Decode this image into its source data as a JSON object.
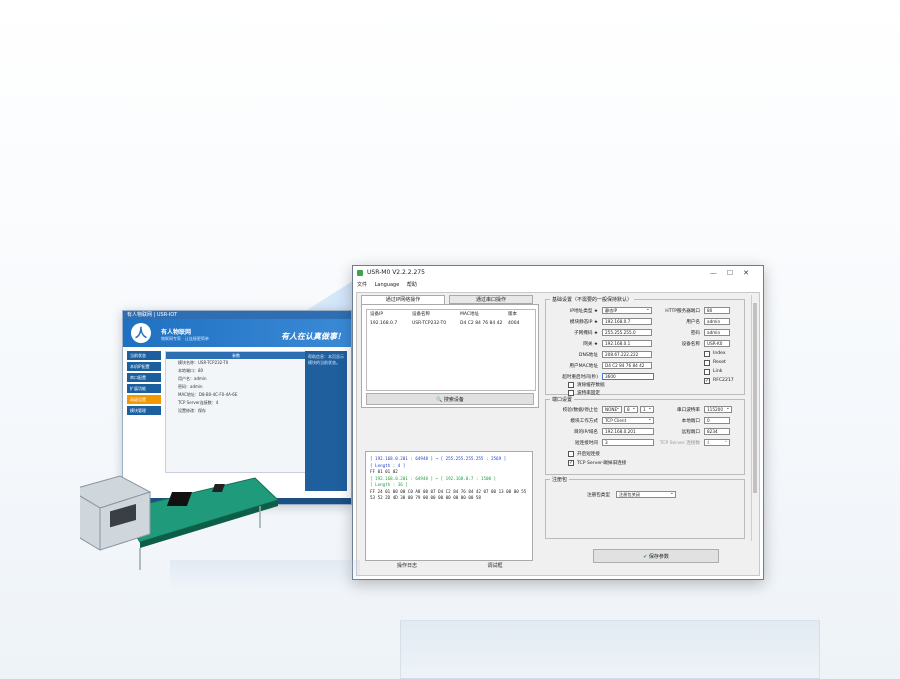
{
  "browser": {
    "titlebar": "有人物联网 | USR-IOT",
    "brand": "有人物联网",
    "brand_sub": "物联网专家 · 让连接更简单",
    "slogan": "有人在认真做事！",
    "side_items": [
      "当前状态",
      "本机IP配置",
      "串口配置",
      "扩展功能",
      "高级设置",
      "模块管理"
    ],
    "content_bar": "参数",
    "content_rows": [
      "模块名称：USR-TCP232-T0",
      "本地端口：80",
      "用户名：admin",
      "密码：admin",
      "MAC地址：D8-B0-4C-F0-4A-6E",
      "TCP Server连接数：4",
      "设置修改：保存"
    ],
    "right_panel": "帮助信息：本页显示模块的当前状态。"
  },
  "app": {
    "title": "USR-M0 V2.2.2.275",
    "menu": [
      "文件",
      "Language",
      "帮助"
    ],
    "window_controls": [
      "—",
      "☐",
      "✕"
    ],
    "tabs": [
      "通过IP网络操作",
      "通过串口操作"
    ],
    "device_list": {
      "headers": [
        "设备IP",
        "设备名称",
        "MAC地址",
        "版本"
      ],
      "rows": [
        [
          "192.168.0.7",
          "USR-TCP232-T0",
          "D4 C2 84 76 84 42",
          "4004"
        ]
      ]
    },
    "search_button": "搜索设备",
    "log": [
      {
        "cls": "blue",
        "text": "[ 192.168.0.201 : 64948 ] → [ 255.255.255.255 : 2569 ]"
      },
      {
        "cls": "blue",
        "text": "[ Length : 4 ]"
      },
      {
        "cls": "",
        "text": "FF 01 01 02"
      },
      {
        "cls": "",
        "text": " "
      },
      {
        "cls": "green",
        "text": "[ 192.168.0.201 : 64948 ] ← [ 192.168.0.7 : 1500 ]"
      },
      {
        "cls": "green",
        "text": "[ Length : 36 ]"
      },
      {
        "cls": "",
        "text": "FF 24 01 00 00 C0 A8 00 07 D4 C2 84 76 84 42 07 00 13 00 00 55 53 52 2D 4D 30 00 79 00 00 00 00 00 00 00 58"
      }
    ],
    "bottom_tabs": [
      "操作日志",
      "调试框"
    ],
    "basic": {
      "group_title": "基础设置（不需要的一般保持默认）",
      "ip_type_label": "IP地址类型 ★",
      "ip_type": "静态IP",
      "ip_label": "模块静态IP ★",
      "ip": "192.168.0.7",
      "mask_label": "子网掩码 ★",
      "mask": "255.255.255.0",
      "gw_label": "网关 ★",
      "gw": "192.168.0.1",
      "dns_label": "DNS地址",
      "dns": "208.67.222.222",
      "mac_label": "用户MAC地址",
      "mac": "D4 C2 84 76 84 42",
      "timeout_label": "超时重启时间(秒)",
      "timeout": "3600",
      "http_port_label": "HTTP服务器端口",
      "http_port": "80",
      "user_label": "用户名",
      "user": "admin",
      "pwd_label": "密码",
      "pwd": "admin",
      "name_label": "设备名称",
      "name": "USR-K0",
      "chk_index": "Index",
      "chk_reset": "Reset",
      "chk_link": "Link",
      "chk_rfc": "RFC2217",
      "chk_clear": "清除缓存数据",
      "chk_baud": "波特率固定"
    },
    "serial": {
      "group_title": "端口设置",
      "check_label": "校验/数据/停止位",
      "check": "NONE",
      "data": "8",
      "stop": "1",
      "baud_label": "串口波特率",
      "baud": "115200",
      "mode_label": "模块工作方式",
      "mode": "TCP Client",
      "local_port_label": "本地端口",
      "local_port": "0",
      "remote_ip_label": "目的IP/域名",
      "remote_ip": "192.168.0.201",
      "remote_port_label": "远程端口",
      "remote_port": "8234",
      "reconnect_label": "短连接时间",
      "reconnect": "3",
      "server_conn_label": "TCP Server 连接数",
      "server_conn": "4",
      "chk_short": "开启短连接",
      "chk_kick": "TCP Server-踢掉旧连接"
    },
    "register": {
      "group_title": "注册包",
      "type_label": "注册包类型",
      "type": "注册包关闭"
    },
    "save_button": "保存参数"
  }
}
